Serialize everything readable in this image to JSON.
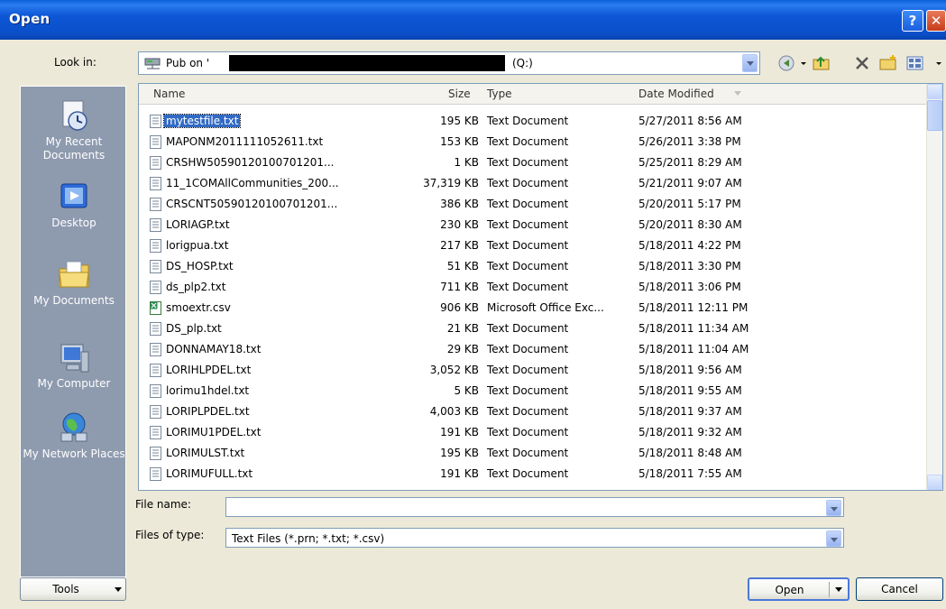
{
  "window": {
    "title": "Open",
    "help_glyph": "?",
    "close_glyph": "✕"
  },
  "look_in": {
    "label": "Look in:",
    "value_prefix": "Pub on '",
    "value_suffix": "(Q:)"
  },
  "places": [
    {
      "label": "My Recent Documents",
      "icon": "recent-documents-icon"
    },
    {
      "label": "Desktop",
      "icon": "desktop-icon"
    },
    {
      "label": "My Documents",
      "icon": "my-documents-icon"
    },
    {
      "label": "My Computer",
      "icon": "my-computer-icon"
    },
    {
      "label": "My Network Places",
      "icon": "network-places-icon"
    }
  ],
  "columns": {
    "name": "Name",
    "size": "Size",
    "type": "Type",
    "date": "Date Modified"
  },
  "files": [
    {
      "name": "mytestfile.txt",
      "size": "195 KB",
      "type": "Text Document",
      "date": "5/27/2011 8:56 AM",
      "selected": true
    },
    {
      "name": "MAPONM2011111052611.txt",
      "size": "153 KB",
      "type": "Text Document",
      "date": "5/26/2011 3:38 PM"
    },
    {
      "name": "CRSHW50590120100701201...",
      "size": "1 KB",
      "type": "Text Document",
      "date": "5/25/2011 8:29 AM"
    },
    {
      "name": "11_1COMAllCommunities_200...",
      "size": "37,319 KB",
      "type": "Text Document",
      "date": "5/21/2011 9:07 AM"
    },
    {
      "name": "CRSCNT50590120100701201...",
      "size": "386 KB",
      "type": "Text Document",
      "date": "5/20/2011 5:17 PM"
    },
    {
      "name": "LORIAGP.txt",
      "size": "230 KB",
      "type": "Text Document",
      "date": "5/20/2011 8:30 AM"
    },
    {
      "name": "lorigpua.txt",
      "size": "217 KB",
      "type": "Text Document",
      "date": "5/18/2011 4:22 PM"
    },
    {
      "name": "DS_HOSP.txt",
      "size": "51 KB",
      "type": "Text Document",
      "date": "5/18/2011 3:30 PM"
    },
    {
      "name": "ds_plp2.txt",
      "size": "711 KB",
      "type": "Text Document",
      "date": "5/18/2011 3:06 PM"
    },
    {
      "name": "smoextr.csv",
      "size": "906 KB",
      "type": "Microsoft Office Exc...",
      "date": "5/18/2011 12:11 PM",
      "excel": true
    },
    {
      "name": "DS_plp.txt",
      "size": "21 KB",
      "type": "Text Document",
      "date": "5/18/2011 11:34 AM"
    },
    {
      "name": "DONNAMAY18.txt",
      "size": "29 KB",
      "type": "Text Document",
      "date": "5/18/2011 11:04 AM"
    },
    {
      "name": "LORIHLPDEL.txt",
      "size": "3,052 KB",
      "type": "Text Document",
      "date": "5/18/2011 9:56 AM"
    },
    {
      "name": "lorimu1hdel.txt",
      "size": "5 KB",
      "type": "Text Document",
      "date": "5/18/2011 9:55 AM"
    },
    {
      "name": "LORIPLPDEL.txt",
      "size": "4,003 KB",
      "type": "Text Document",
      "date": "5/18/2011 9:37 AM"
    },
    {
      "name": "LORIMU1PDEL.txt",
      "size": "191 KB",
      "type": "Text Document",
      "date": "5/18/2011 9:32 AM"
    },
    {
      "name": "LORIMULST.txt",
      "size": "195 KB",
      "type": "Text Document",
      "date": "5/18/2011 8:48 AM"
    },
    {
      "name": "LORIMUFULL.txt",
      "size": "191 KB",
      "type": "Text Document",
      "date": "5/18/2011 7:55 AM"
    }
  ],
  "file_name": {
    "label": "File name:",
    "value": ""
  },
  "file_type": {
    "label": "Files of type:",
    "value": "Text Files (*.prn; *.txt; *.csv)"
  },
  "buttons": {
    "tools": "Tools",
    "open": "Open",
    "cancel": "Cancel"
  },
  "colors": {
    "titlebar": "#0A4FC8",
    "selection": "#316AC5",
    "places_bar": "#8E9AAE",
    "dialog_bg": "#ECE9D8"
  }
}
